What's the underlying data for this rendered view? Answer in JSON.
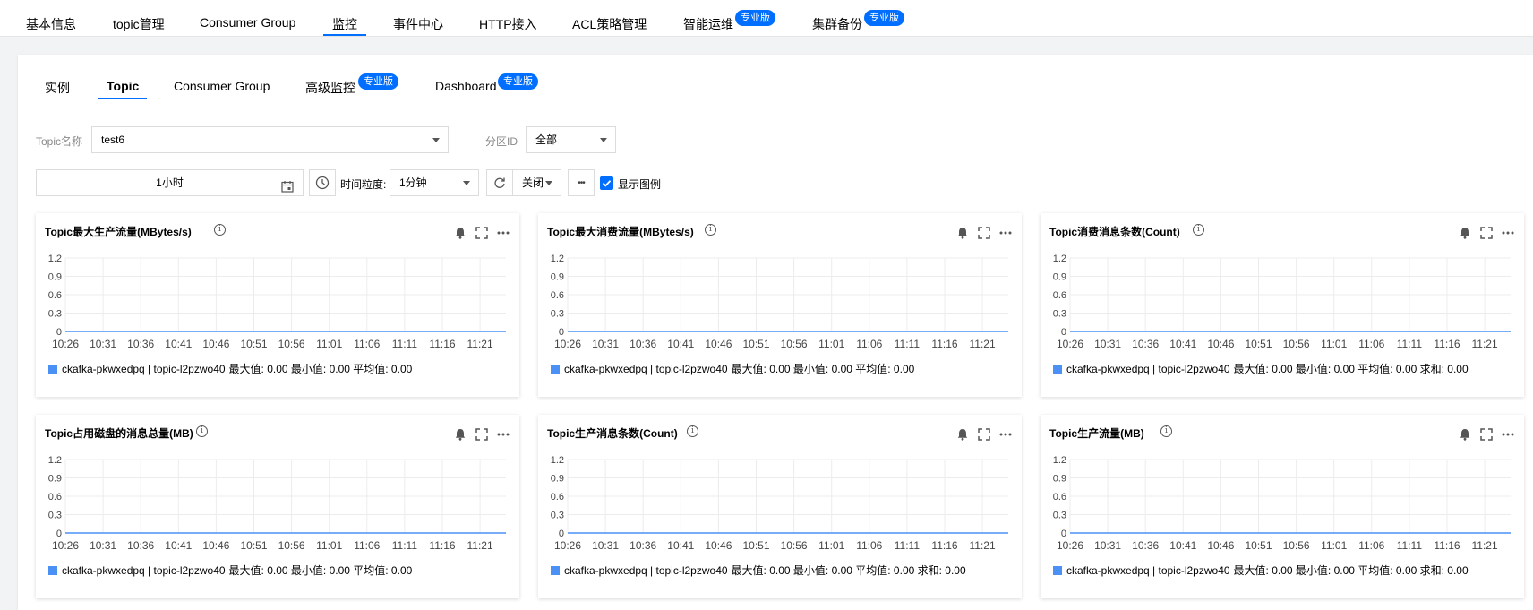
{
  "top_nav": {
    "tabs": [
      {
        "label": "基本信息"
      },
      {
        "label": "topic管理"
      },
      {
        "label": "Consumer Group"
      },
      {
        "label": "监控"
      },
      {
        "label": "事件中心"
      },
      {
        "label": "HTTP接入"
      },
      {
        "label": "ACL策略管理"
      },
      {
        "label": "智能运维",
        "badge": "专业版"
      },
      {
        "label": "集群备份",
        "badge": "专业版"
      }
    ],
    "active": "监控"
  },
  "sub_tabs": {
    "tabs": [
      {
        "label": "实例"
      },
      {
        "label": "Topic"
      },
      {
        "label": "Consumer Group"
      },
      {
        "label": "高级监控",
        "badge": "专业版"
      },
      {
        "label": "Dashboard",
        "badge": "专业版"
      }
    ],
    "active": "Topic"
  },
  "filters": {
    "topic_label": "Topic名称",
    "topic_value": "test6",
    "partition_label": "分区ID",
    "partition_value": "全部"
  },
  "toolbar": {
    "time_range": "1小时",
    "granularity_label": "时间粒度:",
    "granularity_value": "1分钟",
    "refresh_value": "关闭",
    "more": "•••",
    "show_legend_label": "显示图例",
    "show_legend_checked": true
  },
  "colors": {
    "accent": "#006eff",
    "series": "#4a90f5"
  },
  "chart_data": [
    {
      "type": "line",
      "title": "Topic最大生产流量(MBytes/s)",
      "x": [
        "10:26",
        "10:31",
        "10:36",
        "10:41",
        "10:46",
        "10:51",
        "10:56",
        "11:01",
        "11:06",
        "11:11",
        "11:16",
        "11:21"
      ],
      "y_ticks": [
        "1.2",
        "0.9",
        "0.6",
        "0.3",
        "0"
      ],
      "ylim": [
        0,
        1.2
      ],
      "series": [
        {
          "name": "ckafka-pkwxedpq | topic-l2pzwo40",
          "values": [
            0,
            0,
            0,
            0,
            0,
            0,
            0,
            0,
            0,
            0,
            0,
            0
          ]
        }
      ],
      "legend_stats": "最大值: 0.00 最小值: 0.00 平均值: 0.00"
    },
    {
      "type": "line",
      "title": "Topic最大消费流量(MBytes/s)",
      "x": [
        "10:26",
        "10:31",
        "10:36",
        "10:41",
        "10:46",
        "10:51",
        "10:56",
        "11:01",
        "11:06",
        "11:11",
        "11:16",
        "11:21"
      ],
      "y_ticks": [
        "1.2",
        "0.9",
        "0.6",
        "0.3",
        "0"
      ],
      "ylim": [
        0,
        1.2
      ],
      "series": [
        {
          "name": "ckafka-pkwxedpq | topic-l2pzwo40",
          "values": [
            0,
            0,
            0,
            0,
            0,
            0,
            0,
            0,
            0,
            0,
            0,
            0
          ]
        }
      ],
      "legend_stats": "最大值: 0.00 最小值: 0.00 平均值: 0.00"
    },
    {
      "type": "line",
      "title": "Topic消费消息条数(Count)",
      "x": [
        "10:26",
        "10:31",
        "10:36",
        "10:41",
        "10:46",
        "10:51",
        "10:56",
        "11:01",
        "11:06",
        "11:11",
        "11:16",
        "11:21"
      ],
      "y_ticks": [
        "1.2",
        "0.9",
        "0.6",
        "0.3",
        "0"
      ],
      "ylim": [
        0,
        1.2
      ],
      "series": [
        {
          "name": "ckafka-pkwxedpq | topic-l2pzwo40",
          "values": [
            0,
            0,
            0,
            0,
            0,
            0,
            0,
            0,
            0,
            0,
            0,
            0
          ]
        }
      ],
      "legend_stats": "最大值: 0.00 最小值: 0.00 平均值: 0.00 求和: 0.00"
    },
    {
      "type": "line",
      "title": "Topic占用磁盘的消息总量(MB)",
      "x": [
        "10:26",
        "10:31",
        "10:36",
        "10:41",
        "10:46",
        "10:51",
        "10:56",
        "11:01",
        "11:06",
        "11:11",
        "11:16",
        "11:21"
      ],
      "y_ticks": [
        "1.2",
        "0.9",
        "0.6",
        "0.3",
        "0"
      ],
      "ylim": [
        0,
        1.2
      ],
      "series": [
        {
          "name": "ckafka-pkwxedpq | topic-l2pzwo40",
          "values": [
            0,
            0,
            0,
            0,
            0,
            0,
            0,
            0,
            0,
            0,
            0,
            0
          ]
        }
      ],
      "legend_stats": "最大值: 0.00 最小值: 0.00 平均值: 0.00"
    },
    {
      "type": "line",
      "title": "Topic生产消息条数(Count)",
      "x": [
        "10:26",
        "10:31",
        "10:36",
        "10:41",
        "10:46",
        "10:51",
        "10:56",
        "11:01",
        "11:06",
        "11:11",
        "11:16",
        "11:21"
      ],
      "y_ticks": [
        "1.2",
        "0.9",
        "0.6",
        "0.3",
        "0"
      ],
      "ylim": [
        0,
        1.2
      ],
      "series": [
        {
          "name": "ckafka-pkwxedpq | topic-l2pzwo40",
          "values": [
            0,
            0,
            0,
            0,
            0,
            0,
            0,
            0,
            0,
            0,
            0,
            0
          ]
        }
      ],
      "legend_stats": "最大值: 0.00 最小值: 0.00 平均值: 0.00 求和: 0.00"
    },
    {
      "type": "line",
      "title": "Topic生产流量(MB)",
      "x": [
        "10:26",
        "10:31",
        "10:36",
        "10:41",
        "10:46",
        "10:51",
        "10:56",
        "11:01",
        "11:06",
        "11:11",
        "11:16",
        "11:21"
      ],
      "y_ticks": [
        "1.2",
        "0.9",
        "0.6",
        "0.3",
        "0"
      ],
      "ylim": [
        0,
        1.2
      ],
      "series": [
        {
          "name": "ckafka-pkwxedpq | topic-l2pzwo40",
          "values": [
            0,
            0,
            0,
            0,
            0,
            0,
            0,
            0,
            0,
            0,
            0,
            0
          ]
        }
      ],
      "legend_stats": "最大值: 0.00 最小值: 0.00 平均值: 0.00 求和: 0.00"
    }
  ]
}
